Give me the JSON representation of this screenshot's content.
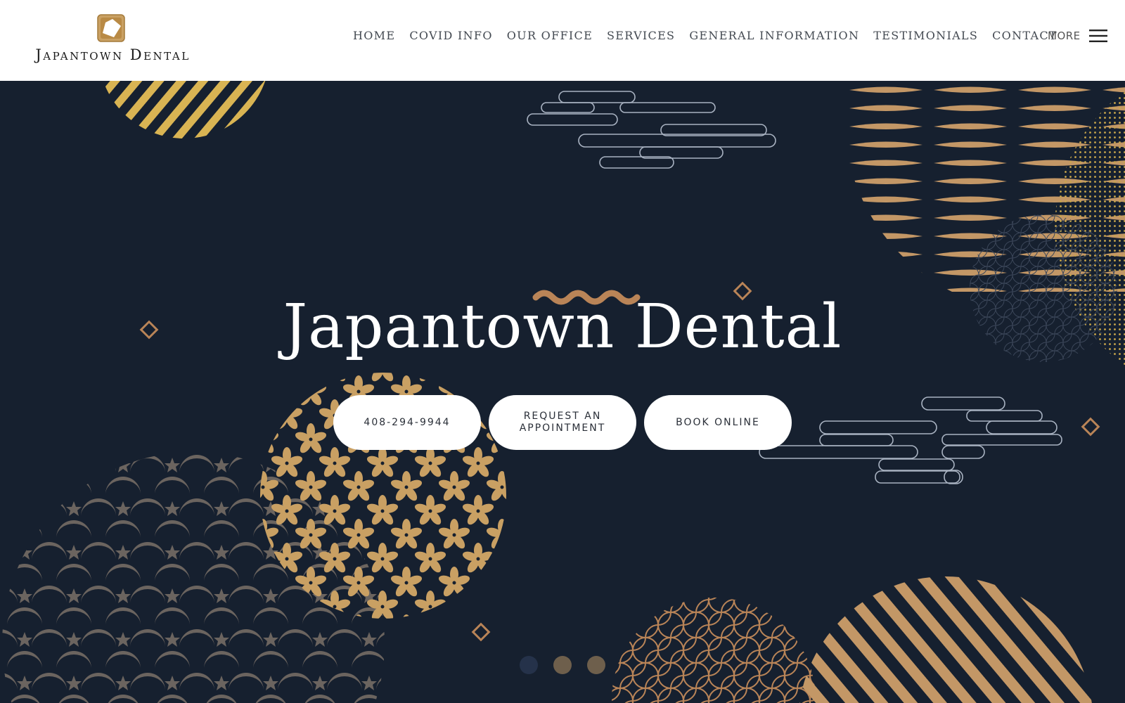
{
  "brand": {
    "name": "Japantown Dental",
    "logo_icon": "logo-mark-icon"
  },
  "nav": {
    "items": [
      {
        "label": "HOME"
      },
      {
        "label": "COVID INFO"
      },
      {
        "label": "OUR OFFICE"
      },
      {
        "label": "SERVICES"
      },
      {
        "label": "GENERAL INFORMATION"
      },
      {
        "label": "TESTIMONIALS"
      },
      {
        "label": "CONTACT"
      }
    ],
    "more_label": "MORE",
    "more_icon": "hamburger-menu-icon"
  },
  "hero": {
    "title": "Japantown Dental",
    "buttons": {
      "phone": "408-294-9944",
      "request_line1": "REQUEST AN",
      "request_line2": "APPOINTMENT",
      "book": "BOOK ONLINE"
    },
    "slides": {
      "count": 3,
      "active_index": 0
    }
  },
  "colors": {
    "background": "#16202f",
    "gold": "#c9a063",
    "copper": "#b98457",
    "taupe": "#6b645f",
    "white": "#ffffff",
    "nav_text": "#444a52"
  }
}
